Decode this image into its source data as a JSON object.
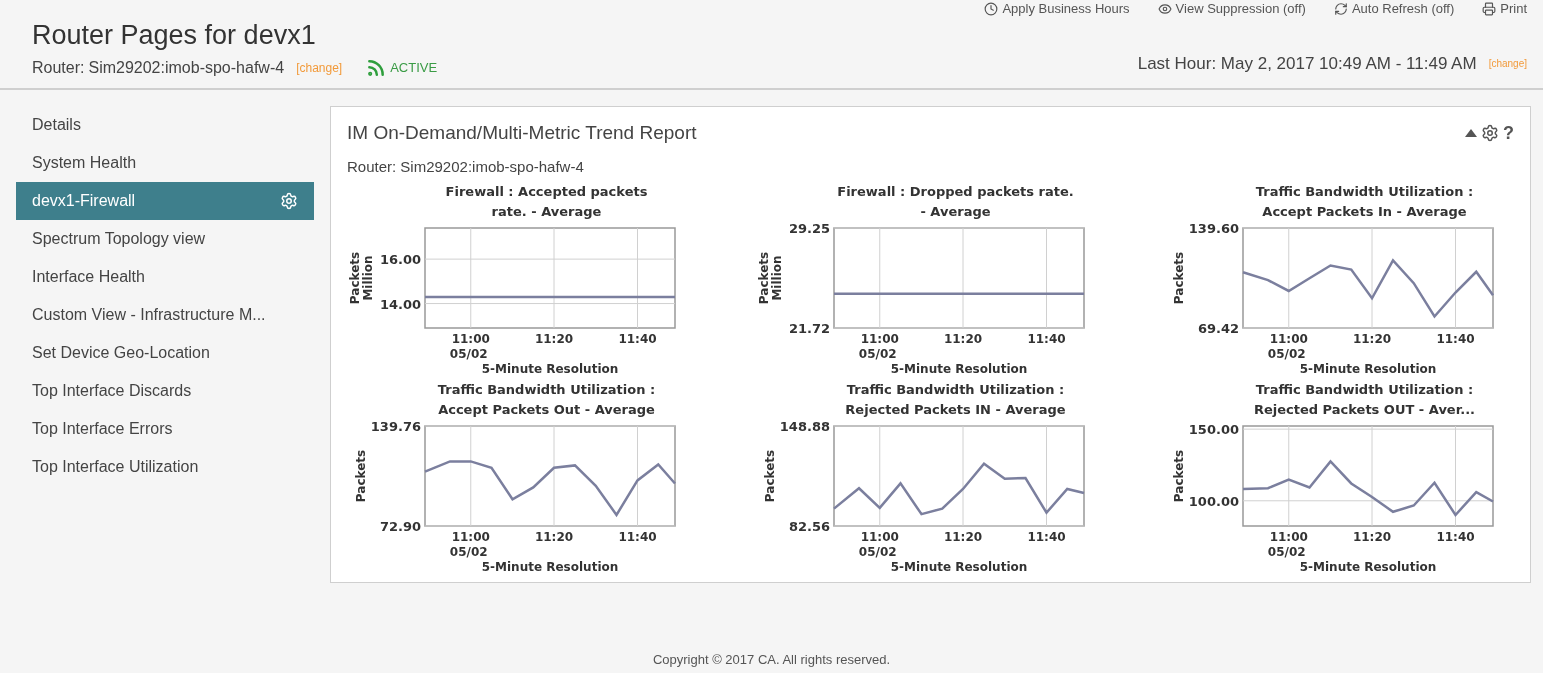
{
  "toolbar": [
    {
      "label": "Apply Business Hours",
      "kind": "clock"
    },
    {
      "label": "View Suppression (off)",
      "kind": "eye"
    },
    {
      "label": "Auto Refresh (off)",
      "kind": "refresh"
    },
    {
      "label": "Print",
      "kind": "print"
    }
  ],
  "header": {
    "title": "Router Pages for devx1",
    "router_label": "Router:",
    "router": "Sim29202:imob-spo-hafw-4",
    "change_link": "[change]",
    "status": "ACTIVE",
    "time_range": "Last Hour: May 2, 2017 10:49 AM - 11:49 AM",
    "time_change_link": "[change]"
  },
  "sidebar": {
    "items": [
      {
        "label": "Details",
        "selected": false
      },
      {
        "label": "System Health",
        "selected": false
      },
      {
        "label": "devx1-Firewall",
        "selected": true
      },
      {
        "label": "Spectrum Topology view",
        "selected": false
      },
      {
        "label": "Interface Health",
        "selected": false
      },
      {
        "label": "Custom View - Infrastructure M...",
        "selected": false
      },
      {
        "label": "Set Device Geo-Location",
        "selected": false
      },
      {
        "label": "Top Interface Discards",
        "selected": false
      },
      {
        "label": "Top Interface Errors",
        "selected": false
      },
      {
        "label": "Top Interface Utilization",
        "selected": false
      }
    ]
  },
  "report": {
    "title": "IM On-Demand/Multi-Metric Trend Report",
    "help_label": "?",
    "subtitle": "Router: Sim29202:imob-spo-hafw-4",
    "charts": [
      {
        "unit": "Million",
        "date_label": "05/02",
        "chart_data": {
          "type": "line",
          "title": "Firewall : Accepted packets rate. - Average",
          "xlabel": "5-Minute Resolution",
          "ylabel": "Packets",
          "grid": true,
          "x": [
            10.817,
            11.817
          ],
          "series": [
            {
              "color": "#7b7f9e",
              "values": [
                14.3,
                14.3
              ]
            }
          ],
          "xlim": [
            10.817,
            11.817
          ],
          "ylim": [
            12.9,
            17.4
          ],
          "xticks": [
            {
              "value": 11,
              "label": "11:00"
            },
            {
              "value": 11.333,
              "label": "11:20"
            },
            {
              "value": 11.667,
              "label": "11:40"
            }
          ],
          "yticks": [
            {
              "value": 14,
              "label": "14.00"
            },
            {
              "value": 16,
              "label": "16.00"
            }
          ]
        }
      },
      {
        "unit": "Million",
        "date_label": "05/02",
        "chart_data": {
          "type": "line",
          "title": "Firewall : Dropped packets rate. - Average",
          "xlabel": "5-Minute Resolution",
          "ylabel": "Packets",
          "grid": true,
          "x": [
            10.817,
            11.817
          ],
          "series": [
            {
              "color": "#7b7f9e",
              "values": [
                24.3,
                24.3
              ]
            }
          ],
          "xlim": [
            10.817,
            11.817
          ],
          "ylim": [
            21.72,
            29.25
          ],
          "xticks": [
            {
              "value": 11,
              "label": "11:00"
            },
            {
              "value": 11.333,
              "label": "11:20"
            },
            {
              "value": 11.667,
              "label": "11:40"
            }
          ],
          "yticks": [
            {
              "value": 21.72,
              "label": "21.72"
            },
            {
              "value": 29.25,
              "label": "29.25"
            }
          ]
        }
      },
      {
        "date_label": "05/02",
        "chart_data": {
          "type": "line",
          "title": "Traffic Bandwidth Utilization : Accept Packets In - Average",
          "xlabel": "5-Minute Resolution",
          "ylabel": "Packets",
          "grid": true,
          "x": [
            10.817,
            10.917,
            11,
            11.083,
            11.167,
            11.25,
            11.333,
            11.417,
            11.5,
            11.583,
            11.667,
            11.75,
            11.817
          ],
          "series": [
            {
              "color": "#7b7f9e",
              "values": [
                108.5,
                103.0,
                95.4,
                104.3,
                113.3,
                110.4,
                90.3,
                116.9,
                100.9,
                77.5,
                94.3,
                108.9,
                92.4
              ]
            }
          ],
          "xlim": [
            10.817,
            11.817
          ],
          "ylim": [
            69.42,
            139.6
          ],
          "xticks": [
            {
              "value": 11,
              "label": "11:00"
            },
            {
              "value": 11.333,
              "label": "11:20"
            },
            {
              "value": 11.667,
              "label": "11:40"
            }
          ],
          "yticks": [
            {
              "value": 69.42,
              "label": "69.42"
            },
            {
              "value": 139.6,
              "label": "139.60"
            }
          ]
        }
      },
      {
        "date_label": "05/02",
        "chart_data": {
          "type": "line",
          "title": "Traffic Bandwidth Utilization : Accept Packets Out - Average",
          "xlabel": "5-Minute Resolution",
          "ylabel": "Packets",
          "grid": true,
          "x": [
            10.817,
            10.917,
            11,
            11.083,
            11.167,
            11.25,
            11.333,
            11.417,
            11.5,
            11.583,
            11.667,
            11.75,
            11.817
          ],
          "series": [
            {
              "color": "#7b7f9e",
              "values": [
                109.2,
                116.1,
                116.1,
                111.8,
                90.8,
                98.7,
                111.8,
                113.4,
                99.8,
                80.3,
                103.4,
                114.0,
                101.3
              ]
            }
          ],
          "xlim": [
            10.817,
            11.817
          ],
          "ylim": [
            72.9,
            139.76
          ],
          "xticks": [
            {
              "value": 11,
              "label": "11:00"
            },
            {
              "value": 11.333,
              "label": "11:20"
            },
            {
              "value": 11.667,
              "label": "11:40"
            }
          ],
          "yticks": [
            {
              "value": 72.9,
              "label": "72.90"
            },
            {
              "value": 139.76,
              "label": "139.76"
            }
          ]
        }
      },
      {
        "date_label": "05/02",
        "chart_data": {
          "type": "line",
          "title": "Traffic Bandwidth Utilization : Rejected Packets IN - Average",
          "xlabel": "5-Minute Resolution",
          "ylabel": "Packets",
          "grid": true,
          "x": [
            10.817,
            10.917,
            11,
            11.083,
            11.167,
            11.25,
            11.333,
            11.417,
            11.5,
            11.583,
            11.667,
            11.75,
            11.817
          ],
          "series": [
            {
              "color": "#7b7f9e",
              "values": [
                94.1,
                107.6,
                94.6,
                110.8,
                90.4,
                94.1,
                107.1,
                123.8,
                113.9,
                114.4,
                91.4,
                107.1,
                104.5
              ]
            }
          ],
          "xlim": [
            10.817,
            11.817
          ],
          "ylim": [
            82.56,
            148.88
          ],
          "xticks": [
            {
              "value": 11,
              "label": "11:00"
            },
            {
              "value": 11.333,
              "label": "11:20"
            },
            {
              "value": 11.667,
              "label": "11:40"
            }
          ],
          "yticks": [
            {
              "value": 82.56,
              "label": "82.56"
            },
            {
              "value": 148.88,
              "label": "148.88"
            }
          ]
        }
      },
      {
        "date_label": "05/02",
        "chart_data": {
          "type": "line",
          "title": "Traffic Bandwidth Utilization : Rejected Packets OUT - Aver...",
          "xlabel": "5-Minute Resolution",
          "ylabel": "Packets",
          "grid": true,
          "x": [
            10.817,
            10.917,
            11,
            11.083,
            11.167,
            11.25,
            11.333,
            11.417,
            11.5,
            11.583,
            11.667,
            11.75,
            11.817
          ],
          "series": [
            {
              "color": "#7b7f9e",
              "values": [
                108.2,
                108.8,
                114.8,
                109.3,
                127.5,
                112.1,
                102.7,
                92.3,
                96.7,
                112.6,
                90.1,
                106.0,
                99.5
              ]
            }
          ],
          "xlim": [
            10.817,
            11.817
          ],
          "ylim": [
            82.4,
            152.2
          ],
          "xticks": [
            {
              "value": 11,
              "label": "11:00"
            },
            {
              "value": 11.333,
              "label": "11:20"
            },
            {
              "value": 11.667,
              "label": "11:40"
            }
          ],
          "yticks": [
            {
              "value": 100,
              "label": "100.00"
            },
            {
              "value": 150,
              "label": "150.00"
            }
          ]
        }
      }
    ]
  },
  "footer": {
    "copyright": "Copyright © 2017 CA. All rights reserved."
  }
}
